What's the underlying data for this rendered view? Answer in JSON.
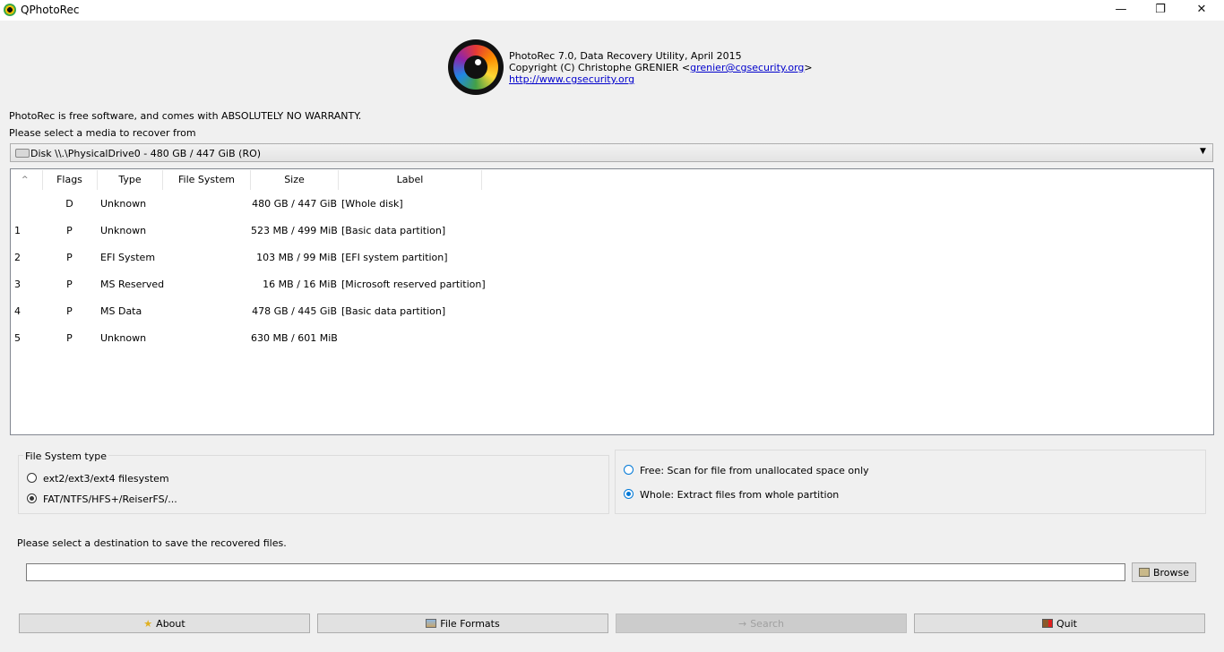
{
  "window": {
    "title": "QPhotoRec",
    "minimize": "—",
    "maximize": "❐",
    "close": "✕"
  },
  "header": {
    "line1": "PhotoRec 7.0, Data Recovery Utility, April 2015",
    "line2_prefix": "Copyright (C) Christophe GRENIER <",
    "email": "grenier@cgsecurity.org",
    "line2_suffix": ">",
    "website": "http://www.cgsecurity.org"
  },
  "notice": "PhotoRec is free software, and comes with ABSOLUTELY NO WARRANTY.",
  "select_prompt": "Please select a media to recover from",
  "media": {
    "selected": "Disk \\\\.\\PhysicalDrive0 - 480 GB / 447 GiB (RO)",
    "arrow": "▼"
  },
  "table": {
    "sort_indicator": "^",
    "headers": [
      "",
      "Flags",
      "Type",
      "File System",
      "Size",
      "Label"
    ],
    "rows": [
      {
        "num": "",
        "flags": "D",
        "type": "Unknown",
        "fs": "",
        "size": "480 GB / 447 GiB",
        "label": "[Whole disk]"
      },
      {
        "num": "1",
        "flags": "P",
        "type": "Unknown",
        "fs": "",
        "size": "523 MB / 499 MiB",
        "label": "[Basic data partition]"
      },
      {
        "num": "2",
        "flags": "P",
        "type": "EFI System",
        "fs": "",
        "size": "103 MB / 99 MiB",
        "label": "[EFI system partition]"
      },
      {
        "num": "3",
        "flags": "P",
        "type": "MS Reserved",
        "fs": "",
        "size": "16 MB / 16 MiB",
        "label": "[Microsoft reserved partition]"
      },
      {
        "num": "4",
        "flags": "P",
        "type": "MS Data",
        "fs": "",
        "size": "478 GB / 445 GiB",
        "label": "[Basic data partition]"
      },
      {
        "num": "5",
        "flags": "P",
        "type": "Unknown",
        "fs": "",
        "size": "630 MB / 601 MiB",
        "label": ""
      }
    ]
  },
  "fs_type": {
    "title": "File System type",
    "options": [
      "ext2/ext3/ext4 filesystem",
      "FAT/NTFS/HFS+/ReiserFS/..."
    ],
    "selected": 1
  },
  "scan_mode": {
    "options": [
      "Free: Scan for file from unallocated space only",
      "Whole: Extract files from whole partition"
    ],
    "selected": 1
  },
  "destination": {
    "prompt": "Please select a destination to save the recovered files.",
    "value": "",
    "browse_label": "Browse"
  },
  "buttons": {
    "about": "About",
    "file_formats": "File Formats",
    "search": "Search",
    "quit": "Quit"
  },
  "icons": {
    "about": "star-icon",
    "file_formats": "image-icon",
    "search": "search-arrow-icon",
    "quit": "exit-door-icon",
    "browse": "folder-icon"
  }
}
